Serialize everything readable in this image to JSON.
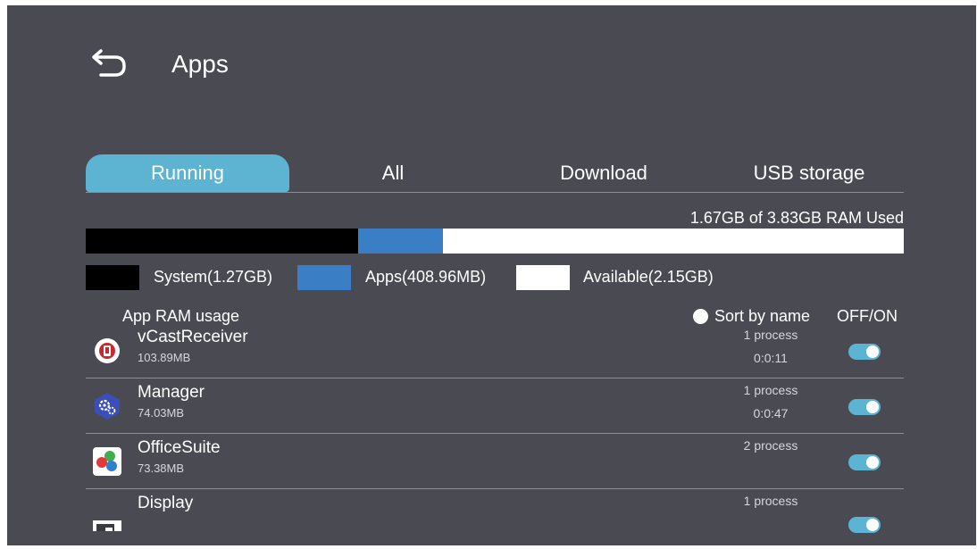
{
  "header": {
    "title": "Apps"
  },
  "tabs": [
    {
      "label": "Running",
      "active": true
    },
    {
      "label": "All",
      "active": false
    },
    {
      "label": "Download",
      "active": false
    },
    {
      "label": "USB storage",
      "active": false
    }
  ],
  "ram": {
    "used_text": "1.67GB of 3.83GB RAM Used",
    "used_gb": 1.67,
    "total_gb": 3.83,
    "segments": [
      {
        "key": "system",
        "label": "System(1.27GB)",
        "gb": 1.27,
        "color": "#000000"
      },
      {
        "key": "apps",
        "label": "Apps(408.96MB)",
        "gb": 0.4,
        "color": "#3a7fc6"
      },
      {
        "key": "available",
        "label": "Available(2.15GB)",
        "gb": 2.15,
        "color": "#ffffff"
      }
    ]
  },
  "list": {
    "section_label": "App RAM usage",
    "sort_label": "Sort by name",
    "toggle_header": "OFF/ON",
    "apps": [
      {
        "name": "vCastReceiver",
        "size": "103.89MB",
        "process": "1 process",
        "time": "0:0:11",
        "icon": "vcast-receiver-icon",
        "enabled": true
      },
      {
        "name": "Manager",
        "size": "74.03MB",
        "process": "1 process",
        "time": "0:0:47",
        "icon": "manager-gear-icon",
        "enabled": true
      },
      {
        "name": "OfficeSuite",
        "size": "73.38MB",
        "process": "2 process",
        "time": "",
        "icon": "officesuite-icon",
        "enabled": true
      },
      {
        "name": "Display",
        "size": "",
        "process": "1 process",
        "time": "",
        "icon": "display-icon",
        "enabled": true
      }
    ]
  },
  "colors": {
    "accent": "#5cb4d2",
    "background": "#4a4a52",
    "divider": "#8d8d94"
  }
}
